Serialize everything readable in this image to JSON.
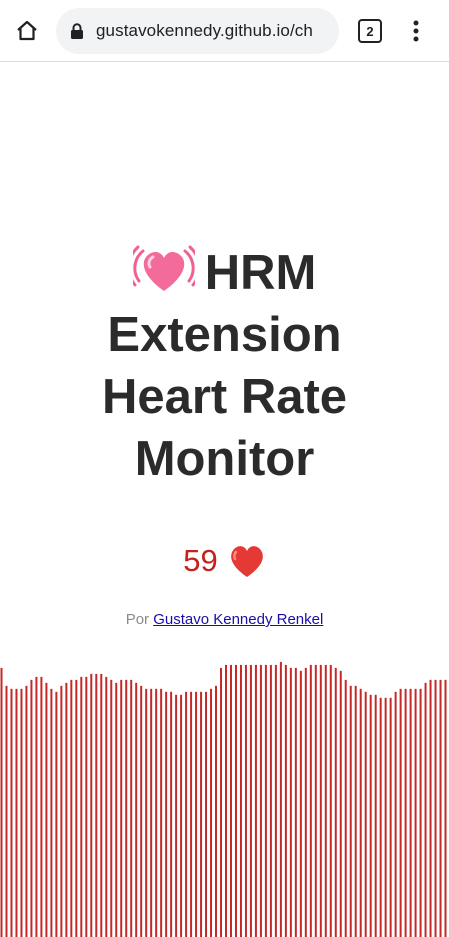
{
  "browser": {
    "url": "gustavokennedy.github.io/ch",
    "tab_count": "2",
    "icons": {
      "home": "home-icon",
      "lock": "lock-icon",
      "tabs": "tab-switcher-icon",
      "menu": "more-vert-icon"
    }
  },
  "page": {
    "title_line1": "HRM",
    "title_line2": "Extension",
    "title_line3": "Heart Rate",
    "title_line4": "Monitor",
    "title_emoji": "beating-heart-icon",
    "bpm": "59",
    "bpm_icon": "red-heart-icon",
    "author_prefix": "Por",
    "author_name": "Gustavo Kennedy Renkel"
  },
  "colors": {
    "bar_color": "#c62828",
    "bpm_color": "#c5221f",
    "title_color": "#2b2b2b",
    "link_color": "#1a0dab"
  },
  "chart_data": {
    "type": "bar",
    "values": [
      90,
      84,
      83,
      83,
      83,
      84,
      86,
      87,
      87,
      85,
      83,
      82,
      84,
      85,
      86,
      86,
      87,
      87,
      88,
      88,
      88,
      87,
      86,
      85,
      86,
      86,
      86,
      85,
      84,
      83,
      83,
      83,
      83,
      82,
      82,
      81,
      81,
      82,
      82,
      82,
      82,
      82,
      83,
      84,
      90,
      91,
      91,
      91,
      91,
      91,
      91,
      91,
      91,
      91,
      91,
      91,
      92,
      91,
      90,
      90,
      89,
      90,
      91,
      91,
      91,
      91,
      91,
      90,
      89,
      86,
      84,
      84,
      83,
      82,
      81,
      81,
      80,
      80,
      80,
      82,
      83,
      83,
      83,
      83,
      83,
      85,
      86,
      86,
      86,
      86
    ]
  }
}
